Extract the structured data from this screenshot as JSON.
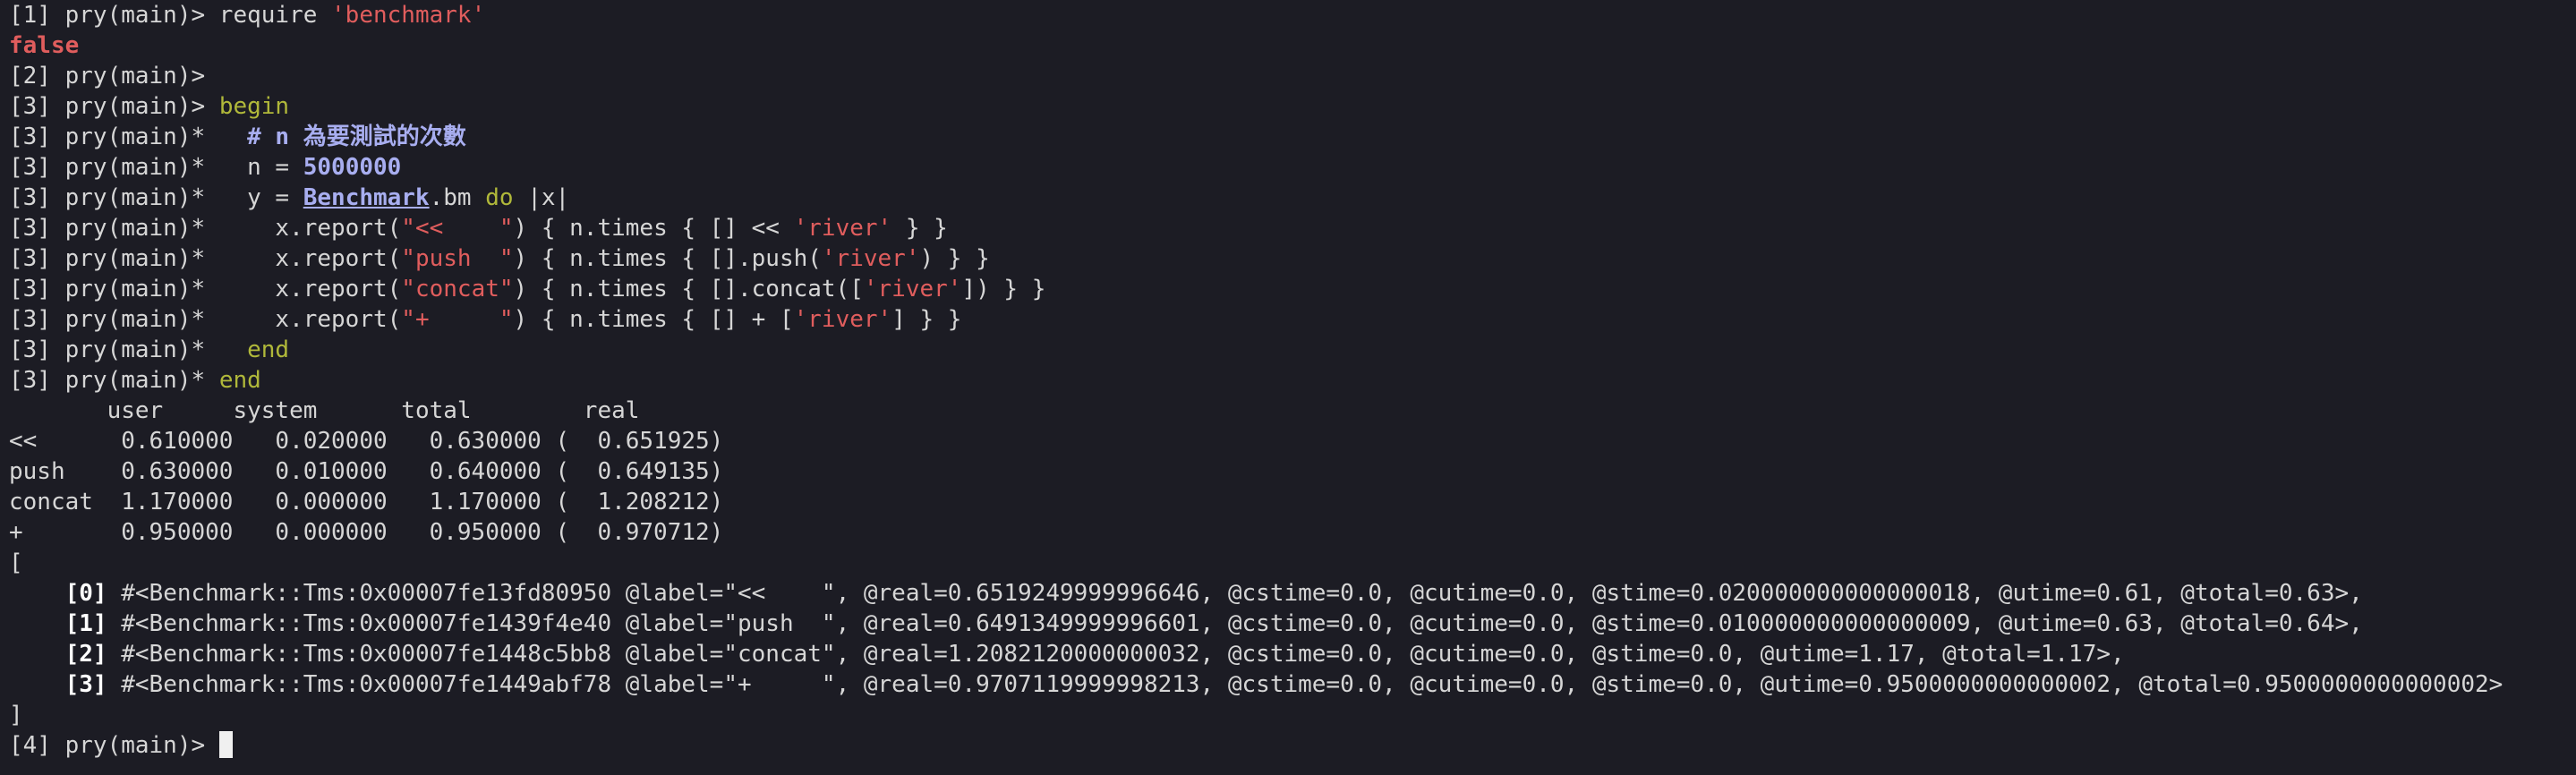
{
  "lines": [
    [
      {
        "t": "[1] pry(main)> require "
      },
      {
        "t": "'benchmark'",
        "c": "s"
      }
    ],
    [
      {
        "t": "false",
        "c": "fls"
      }
    ],
    [
      {
        "t": "[2] pry(main)>"
      }
    ],
    [
      {
        "t": "[3] pry(main)> "
      },
      {
        "t": "begin",
        "c": "kw"
      }
    ],
    [
      {
        "t": "[3] pry(main)*   "
      },
      {
        "t": "# n 為要測試的次數",
        "c": "cm"
      }
    ],
    [
      {
        "t": "[3] pry(main)*   n = "
      },
      {
        "t": "5000000",
        "c": "num"
      }
    ],
    [
      {
        "t": "[3] pry(main)*   y = "
      },
      {
        "t": "Benchmark",
        "c": "cls"
      },
      {
        "t": ".bm "
      },
      {
        "t": "do",
        "c": "kw"
      },
      {
        "t": " |x|"
      }
    ],
    [
      {
        "t": "[3] pry(main)*     x.report("
      },
      {
        "t": "\"<<    \"",
        "c": "s"
      },
      {
        "t": ") { n.times { [] << "
      },
      {
        "t": "'river'",
        "c": "s"
      },
      {
        "t": " } }"
      }
    ],
    [
      {
        "t": "[3] pry(main)*     x.report("
      },
      {
        "t": "\"push  \"",
        "c": "s"
      },
      {
        "t": ") { n.times { [].push("
      },
      {
        "t": "'river'",
        "c": "s"
      },
      {
        "t": ") } }"
      }
    ],
    [
      {
        "t": "[3] pry(main)*     x.report("
      },
      {
        "t": "\"concat\"",
        "c": "s"
      },
      {
        "t": ") { n.times { [].concat(["
      },
      {
        "t": "'river'",
        "c": "s"
      },
      {
        "t": "]) } }"
      }
    ],
    [
      {
        "t": "[3] pry(main)*     x.report("
      },
      {
        "t": "\"+     \"",
        "c": "s"
      },
      {
        "t": ") { n.times { [] + ["
      },
      {
        "t": "'river'",
        "c": "s"
      },
      {
        "t": "] } }"
      }
    ],
    [
      {
        "t": "[3] pry(main)*   "
      },
      {
        "t": "end",
        "c": "kw"
      }
    ],
    [
      {
        "t": "[3] pry(main)* "
      },
      {
        "t": "end",
        "c": "kw"
      }
    ],
    [
      {
        "t": "       user     system      total        real"
      }
    ],
    [
      {
        "t": "<<      0.610000   0.020000   0.630000 (  0.651925)"
      }
    ],
    [
      {
        "t": "push    0.630000   0.010000   0.640000 (  0.649135)"
      }
    ],
    [
      {
        "t": "concat  1.170000   0.000000   1.170000 (  1.208212)"
      }
    ],
    [
      {
        "t": "+       0.950000   0.000000   0.950000 (  0.970712)"
      }
    ],
    [
      {
        "t": "["
      }
    ],
    [
      {
        "t": "    "
      },
      {
        "t": "[0]",
        "c": "bold"
      },
      {
        "t": " #<Benchmark::Tms:0x00007fe13fd80950 @label=\"<<    \", @real=0.6519249999996646, @cstime=0.0, @cutime=0.0, @stime=0.020000000000000018, @utime=0.61, @total=0.63>,"
      }
    ],
    [
      {
        "t": "    "
      },
      {
        "t": "[1]",
        "c": "bold"
      },
      {
        "t": " #<Benchmark::Tms:0x00007fe1439f4e40 @label=\"push  \", @real=0.6491349999996601, @cstime=0.0, @cutime=0.0, @stime=0.010000000000000009, @utime=0.63, @total=0.64>,"
      }
    ],
    [
      {
        "t": "    "
      },
      {
        "t": "[2]",
        "c": "bold"
      },
      {
        "t": " #<Benchmark::Tms:0x00007fe1448c5bb8 @label=\"concat\", @real=1.2082120000000032, @cstime=0.0, @cutime=0.0, @stime=0.0, @utime=1.17, @total=1.17>,"
      }
    ],
    [
      {
        "t": "    "
      },
      {
        "t": "[3]",
        "c": "bold"
      },
      {
        "t": " #<Benchmark::Tms:0x00007fe1449abf78 @label=\"+     \", @real=0.9707119999998213, @cstime=0.0, @cutime=0.0, @stime=0.0, @utime=0.9500000000000002, @total=0.9500000000000002>"
      }
    ],
    [
      {
        "t": "]"
      }
    ],
    [
      {
        "t": "[4] pry(main)> "
      }
    ]
  ],
  "colors": {
    "background": "#1c1c24",
    "foreground": "#d6d6d6",
    "string": "#e05d5d",
    "keyword": "#b0b83a",
    "constant": "#a8aef0"
  }
}
